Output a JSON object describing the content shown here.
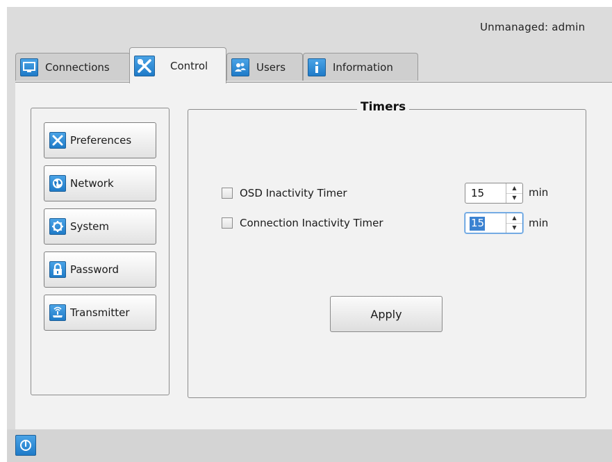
{
  "status": {
    "user_label": "Unmanaged: admin"
  },
  "tabs": [
    {
      "label": "Connections",
      "icon": "monitor-icon"
    },
    {
      "label": "Control",
      "icon": "tools-icon",
      "active": true
    },
    {
      "label": "Users",
      "icon": "users-icon"
    },
    {
      "label": "Information",
      "icon": "info-icon"
    }
  ],
  "sidebar": {
    "items": [
      {
        "label": "Preferences",
        "icon": "tools-icon"
      },
      {
        "label": "Network",
        "icon": "globe-icon"
      },
      {
        "label": "System",
        "icon": "gear-icon"
      },
      {
        "label": "Password",
        "icon": "lock-icon"
      },
      {
        "label": "Transmitter",
        "icon": "transmitter-icon"
      }
    ]
  },
  "timers": {
    "title": "Timers",
    "osd": {
      "label": "OSD Inactivity Timer",
      "value": "15",
      "unit": "min",
      "checked": false
    },
    "connection": {
      "label": "Connection Inactivity Timer",
      "value": "15",
      "unit": "min",
      "checked": false
    },
    "apply_label": "Apply"
  },
  "colors": {
    "accent": "#1f7bc8",
    "panel": "#f2f2f2",
    "background": "#dcdcdc"
  },
  "bottom": {
    "power_icon": "power-icon"
  }
}
